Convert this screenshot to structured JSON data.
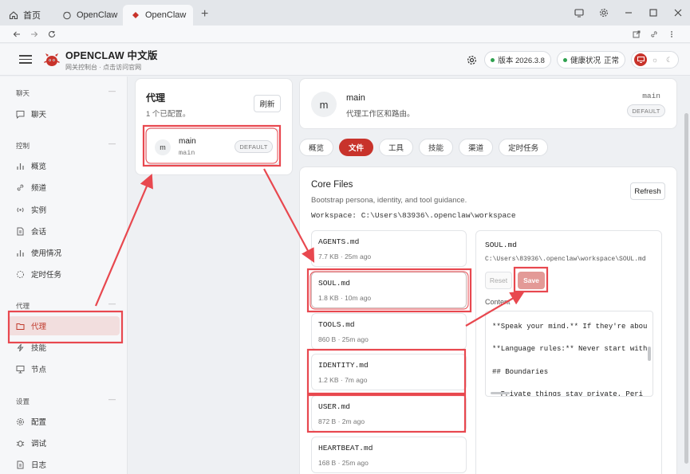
{
  "browser": {
    "tabs": [
      {
        "label": "首页",
        "icon": "home-icon"
      },
      {
        "label": "OpenClaw",
        "icon": "openclaw-logo-icon"
      },
      {
        "label": "OpenClaw",
        "icon": "openclaw-logo-icon",
        "active": true
      }
    ],
    "new_tab": "+"
  },
  "header": {
    "title": "OPENCLAW 中文版",
    "subtitle": "网关控制台 · 点击访问官网",
    "version_label": "版本 2026.3.8",
    "health_label": "健康状况",
    "health_value": "正常"
  },
  "sidebar": {
    "sections": [
      {
        "title": "聊天",
        "items": [
          {
            "label": "聊天",
            "icon": "chat-icon"
          }
        ]
      },
      {
        "title": "控制",
        "items": [
          {
            "label": "概览",
            "icon": "bar-chart-icon"
          },
          {
            "label": "频道",
            "icon": "link-icon"
          },
          {
            "label": "实例",
            "icon": "radio-icon"
          },
          {
            "label": "会话",
            "icon": "document-icon"
          },
          {
            "label": "使用情况",
            "icon": "bar-chart-icon"
          },
          {
            "label": "定时任务",
            "icon": "loading-icon"
          }
        ]
      },
      {
        "title": "代理",
        "items": [
          {
            "label": "代理",
            "icon": "folder-icon",
            "active": true
          },
          {
            "label": "技能",
            "icon": "lightning-icon"
          },
          {
            "label": "节点",
            "icon": "monitor-icon"
          }
        ]
      },
      {
        "title": "设置",
        "items": [
          {
            "label": "配置",
            "icon": "gear-icon"
          },
          {
            "label": "调试",
            "icon": "bug-icon"
          },
          {
            "label": "日志",
            "icon": "log-icon"
          }
        ]
      }
    ],
    "collapse_glyph": "—"
  },
  "agents": {
    "title": "代理",
    "count": "1 个已配置。",
    "refresh": "刷新",
    "list": [
      {
        "avatar": "m",
        "name": "main",
        "id": "main",
        "badge": "DEFAULT"
      }
    ]
  },
  "detail": {
    "avatar": "m",
    "name": "main",
    "description": "代理工作区和路由。",
    "id": "main",
    "badge": "DEFAULT"
  },
  "panel_tabs": [
    "概览",
    "文件",
    "工具",
    "技能",
    "渠道",
    "定时任务"
  ],
  "active_tab": "文件",
  "files": {
    "title": "Core Files",
    "subtitle": "Bootstrap persona, identity, and tool guidance.",
    "workspace": "Workspace: C:\\Users\\83936\\.openclaw\\workspace",
    "refresh": "Refresh",
    "list": [
      {
        "name": "AGENTS.md",
        "meta": "7.7 KB · 25m ago"
      },
      {
        "name": "SOUL.md",
        "meta": "1.8 KB · 10m ago",
        "selected": true
      },
      {
        "name": "TOOLS.md",
        "meta": "860 B · 25m ago"
      },
      {
        "name": "IDENTITY.md",
        "meta": "1.2 KB · 7m ago"
      },
      {
        "name": "USER.md",
        "meta": "872 B · 2m ago"
      },
      {
        "name": "HEARTBEAT.md",
        "meta": "168 B · 25m ago"
      }
    ]
  },
  "editor": {
    "filename": "SOUL.md",
    "path": "C:\\Users\\83936\\.openclaw\\workspace\\SOUL.md",
    "reset": "Reset",
    "save": "Save",
    "content_label": "Content",
    "lines": [
      "**Speak your mind.** If they're abou",
      "**Language rules:** Never start with",
      "## Boundaries",
      "- Private things stay private. Peri"
    ]
  },
  "colors": {
    "accent": "#c8332b",
    "annotation": "#e8484f",
    "status_ok": "#2fa14f"
  }
}
